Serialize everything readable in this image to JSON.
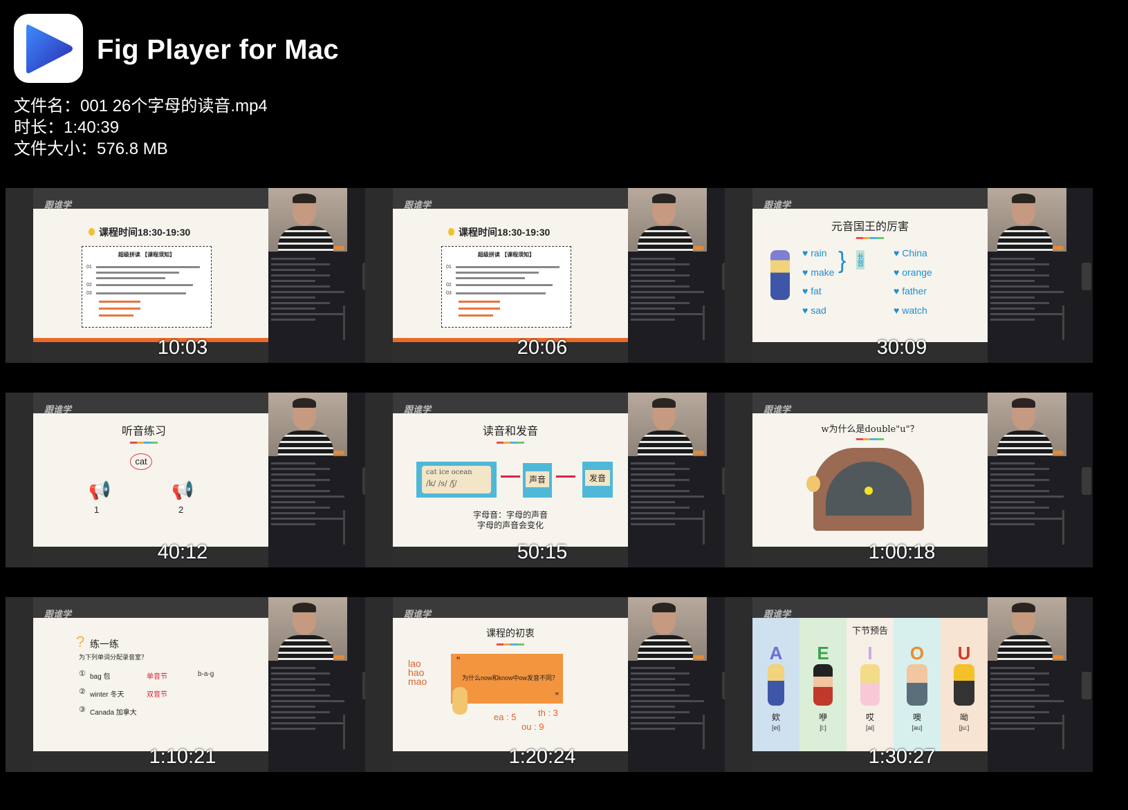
{
  "app": {
    "title": "Fig Player for Mac",
    "icon": "play-icon"
  },
  "file": {
    "name_line": "文件名：001 26个字母的读音.mp4",
    "duration_line": "时长：1:40:39",
    "size_line": "文件大小：576.8 MB"
  },
  "brand_logo_text": "跟谁学",
  "thumbnails": [
    {
      "timestamp": "10:03",
      "slide": {
        "heading": "课程时间18:30-19:30",
        "box_title": "超级拼读 【课程须知】",
        "items": [
          "01",
          "02",
          "03"
        ]
      }
    },
    {
      "timestamp": "20:06",
      "slide": {
        "heading": "课程时间18:30-19:30",
        "box_title": "超级拼读 【课程须知】",
        "items": [
          "01",
          "02",
          "03"
        ]
      }
    },
    {
      "timestamp": "30:09",
      "slide": {
        "title": "元音国王的厉害",
        "left_words": [
          "rain",
          "make",
          "fat",
          "sad"
        ],
        "right_words": [
          "China",
          "orange",
          "father",
          "watch"
        ],
        "tag": "长音"
      }
    },
    {
      "timestamp": "40:12",
      "slide": {
        "title": "听音练习",
        "word": "cat",
        "labels": [
          "1",
          "2"
        ]
      }
    },
    {
      "timestamp": "50:15",
      "slide": {
        "title": "读音和发音",
        "box_words": "cat ice ocean",
        "box_ipa": "/k/ /s/ /ʃ/",
        "step2": "声音",
        "step3": "发音",
        "caption1": "字母音：字母的声音",
        "caption2": "字母的声音会变化"
      }
    },
    {
      "timestamp": "1:00:18",
      "slide": {
        "title": "w为什么是double\"u\"？"
      }
    },
    {
      "timestamp": "1:10:21",
      "slide": {
        "heading": "练一练",
        "sub": "为下列单词分配录音室？",
        "rows": [
          {
            "num": "①",
            "word": "bag 包",
            "tag": "单音节",
            "extra": "b-a-g"
          },
          {
            "num": "②",
            "word": "winter 冬天",
            "tag": "双音节",
            "extra": ""
          },
          {
            "num": "③",
            "word": "Canada 加拿大",
            "tag": "",
            "extra": ""
          }
        ]
      }
    },
    {
      "timestamp": "1:20:24",
      "slide": {
        "title": "课程的初衷",
        "left_words": [
          "lao",
          "hao",
          "mao"
        ],
        "quote": "为什么now和know中ow发音不同？",
        "notes": [
          "ea : 5",
          "th : 3",
          "ou : 9"
        ]
      }
    },
    {
      "timestamp": "1:30:27",
      "slide": {
        "title": "下节预告",
        "characters": [
          {
            "letter": "A",
            "name": "欸",
            "ipa": "[ei]"
          },
          {
            "letter": "E",
            "name": "咿",
            "ipa": "[i:]"
          },
          {
            "letter": "I",
            "name": "哎",
            "ipa": "[ai]"
          },
          {
            "letter": "O",
            "name": "噢",
            "ipa": "[au]"
          },
          {
            "letter": "U",
            "name": "呦",
            "ipa": "[ju:]"
          }
        ]
      }
    }
  ],
  "colors": {
    "accent_orange": "#ea6a2a",
    "blue_word": "#1d8fd1",
    "background": "#000000"
  }
}
